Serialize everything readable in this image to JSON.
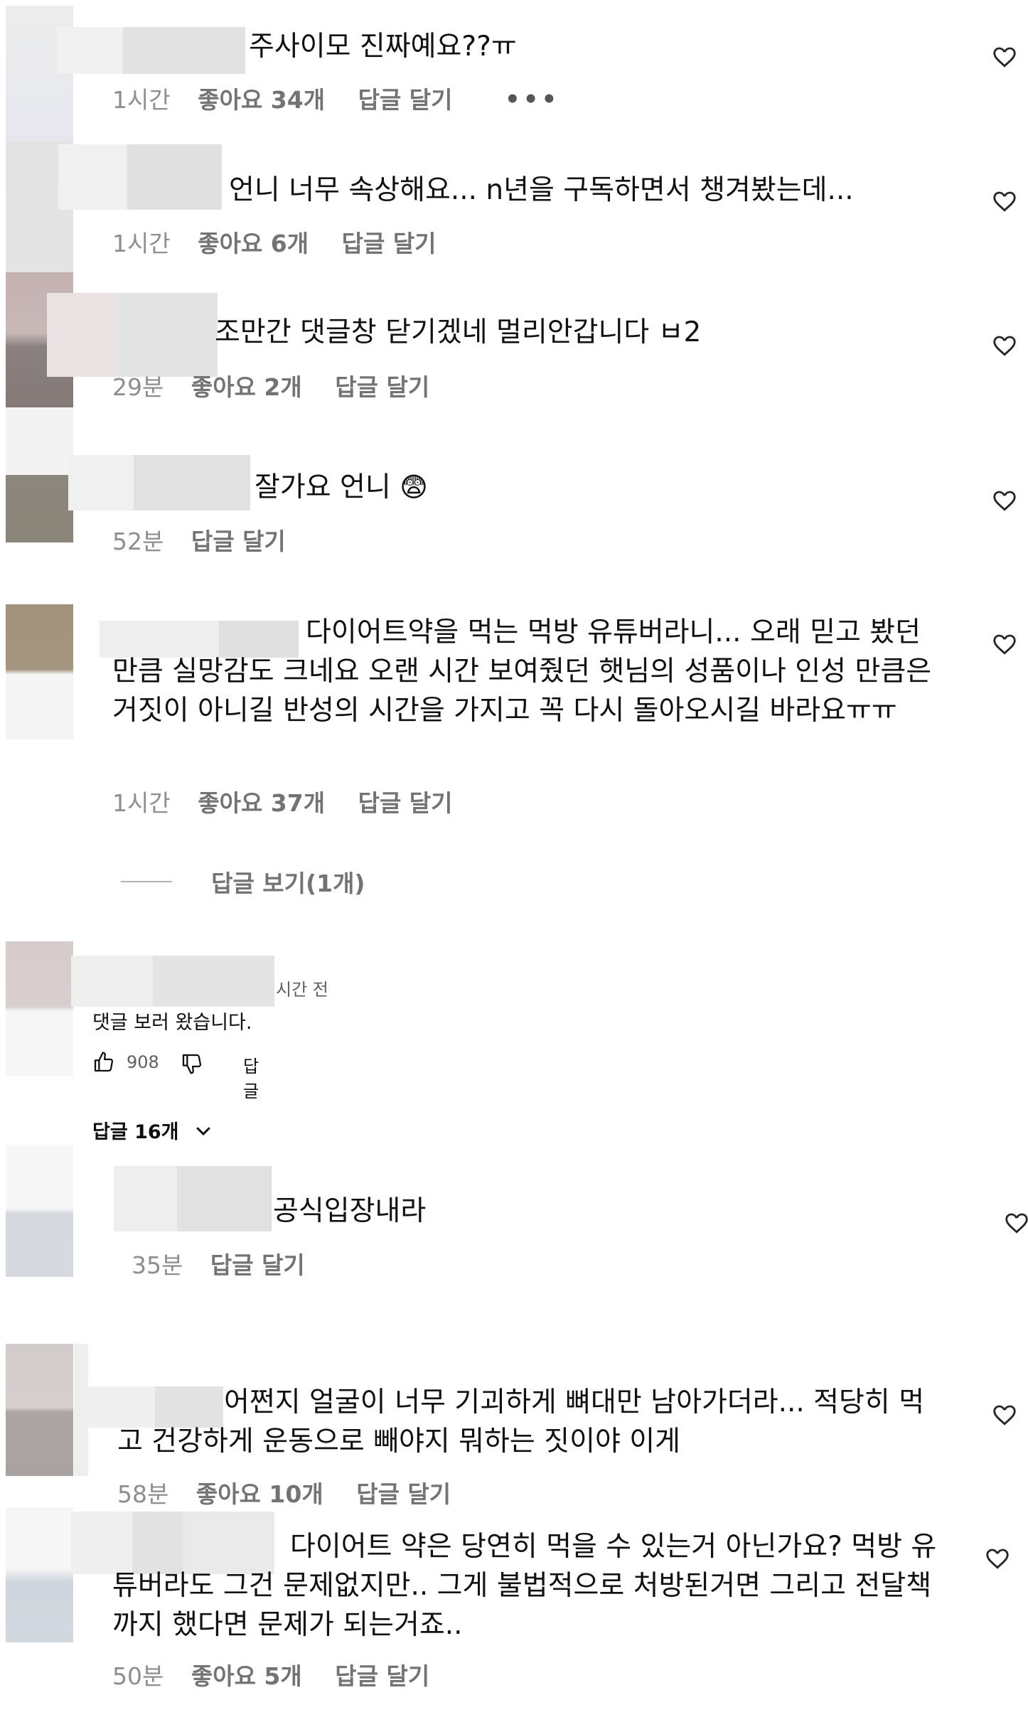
{
  "comments": [
    {
      "text": "주사이모 진짜예요??ㅠ",
      "time": "1시간",
      "likes": "좋아요 34개",
      "reply": "답글 달기",
      "more": "•••"
    },
    {
      "text": "언니 너무 속상해요... n년을 구독하면서 챙겨봤는데...",
      "time": "1시간",
      "likes": "좋아요 6개",
      "reply": "답글 달기"
    },
    {
      "text": "조만간 댓글창 닫기겠네 멀리안갑니다 ㅂ2",
      "time": "29분",
      "likes": "좋아요 2개",
      "reply": "답글 달기"
    },
    {
      "text": "잘가요 언니",
      "emoji": "😨",
      "time": "52분",
      "reply": "답글 달기"
    },
    {
      "text": "다이어트약을 먹는 먹방 유튜버라니... 오래 믿고 봤던 만큼 실망감도 크네요 오랜 시간 보여줬던 햇님의 성품이나 인성 만큼은 거짓이 아니길 반성의 시간을 가지고 꼭 다시 돌아오시길 바라요ㅠㅠ",
      "time": "1시간",
      "likes": "좋아요 37개",
      "reply": "답글 달기",
      "view_replies": "답글 보기(1개)"
    }
  ],
  "youtube": {
    "time": "시간 전",
    "text": "댓글 보러 왔습니다.",
    "likes": "908",
    "reply": "답글",
    "replies_toggle": "답글 16개"
  },
  "comments2": [
    {
      "text": "공식입장내라",
      "time": "35분",
      "reply": "답글 달기"
    },
    {
      "text": "어쩐지 얼굴이 너무 기괴하게 뼈대만 남아가더라... 적당히 먹고 건강하게 운동으로 빼야지 뭐하는 짓이야 이게",
      "time": "58분",
      "likes": "좋아요 10개",
      "reply": "답글 달기"
    },
    {
      "text": "다이어트 약은 당연히 먹을 수 있는거 아닌가요? 먹방 유튜버라도 그건 문제없지만.. 그게 불법적으로 처방된거면 그리고 전달책까지 했다면 문제가 되는거죠..",
      "time": "50분",
      "likes": "좋아요 5개",
      "reply": "답글 달기"
    }
  ],
  "colors": {
    "meta": "#8e8e8e",
    "text": "#111111",
    "blur": "#e6e6e6"
  },
  "icons": [
    "heart-icon",
    "thumbs-up-icon",
    "thumbs-down-icon",
    "chevron-down-icon",
    "more-icon"
  ]
}
